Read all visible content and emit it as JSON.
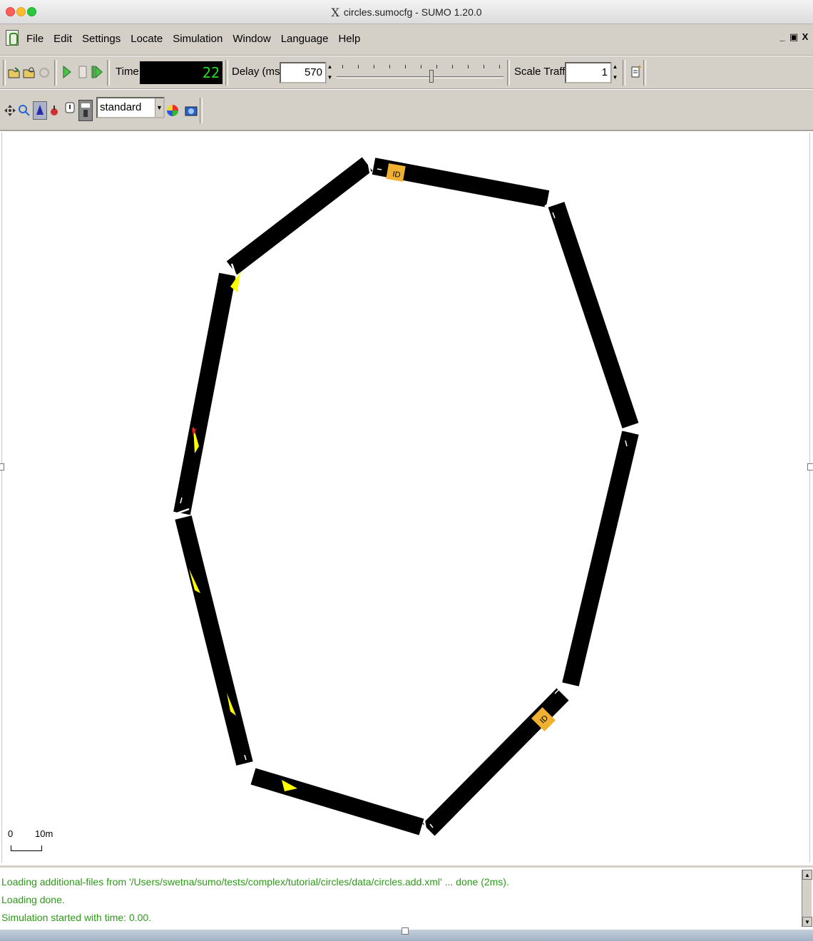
{
  "window": {
    "x_label": "X",
    "title": "circles.sumocfg - SUMO 1.20.0"
  },
  "menu": [
    "File",
    "Edit",
    "Settings",
    "Locate",
    "Simulation",
    "Window",
    "Language",
    "Help"
  ],
  "window_controls": [
    "_",
    "▣",
    "X"
  ],
  "toolbar": {
    "time_label": "Time:",
    "time_value": "22",
    "delay_label": "Delay (ms):",
    "delay_value": "570",
    "delay_slider_level": 0.57,
    "scale_label": "Scale Traffic:",
    "scale_value": "1"
  },
  "view_toolbar": {
    "scheme": "standard"
  },
  "canvas": {
    "scale_zero": "0",
    "scale_ten": "10m"
  },
  "log": [
    "Loading additional-files from '/Users/swetna/sumo/tests/complex/tutorial/circles/data/circles.add.xml' ... done (2ms).",
    "Loading done.",
    "Simulation started with time: 0.00."
  ],
  "colors": {
    "road": "#000000",
    "vehicle": "#ffff00",
    "detector": "#f0b030",
    "log_text": "#2b9a17",
    "time_digits": "#1fe21f"
  }
}
